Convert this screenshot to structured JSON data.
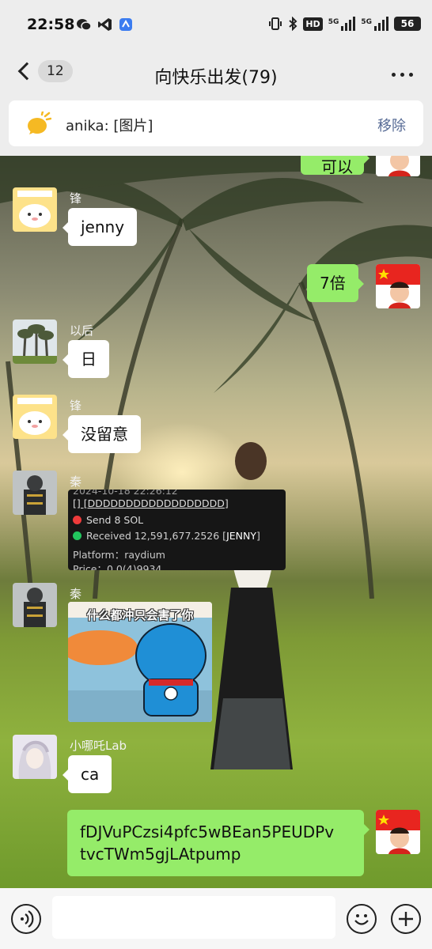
{
  "status": {
    "time": "22:58",
    "hd": "HD",
    "network_a": "5G",
    "network_b": "5G",
    "battery": "56"
  },
  "nav": {
    "unread": "12",
    "title": "向快乐出发(79)"
  },
  "pinned": {
    "text": "anika: [图片]",
    "remove": "移除"
  },
  "messages": {
    "top_partial": "可以",
    "m1_nick": "锋",
    "m1_text": "jenny",
    "m2_text": "7倍",
    "m3_nick": "以后",
    "m3_text": "日",
    "m4_nick": "锋",
    "m4_text": "没留意",
    "m5_nick": "秦",
    "trade": {
      "header": "2024-10-18 22:26:12",
      "pair": "[] [DDDDDDDDDDDDDDDDDD]",
      "send": "Send 8 SOL",
      "received_prefix": "Received 12,591,677.2526 [",
      "received_token": "JENNY",
      "received_suffix": "]",
      "platform": "Platform：raydium",
      "price": "Price：0.0(4)9934"
    },
    "m6_nick": "秦",
    "sticker_caption": "什么都冲只会害了你",
    "m7_nick": "小哪吒Lab",
    "m7_text": "ca",
    "m8_line1": "fDJVuPCzsi4pfc5wBEan5PEUDPv",
    "m8_line2": "tvcTWm5gjLAtpump"
  },
  "colors": {
    "bubble_green": "#95ec69",
    "link_blue": "#576b95",
    "send_red": "#ee3b3b",
    "receive_green": "#22c55e"
  },
  "icons": [
    "back-chevron-icon",
    "more-icon",
    "pinned-speaker-icon",
    "voice-icon",
    "emoji-icon",
    "plus-icon"
  ]
}
